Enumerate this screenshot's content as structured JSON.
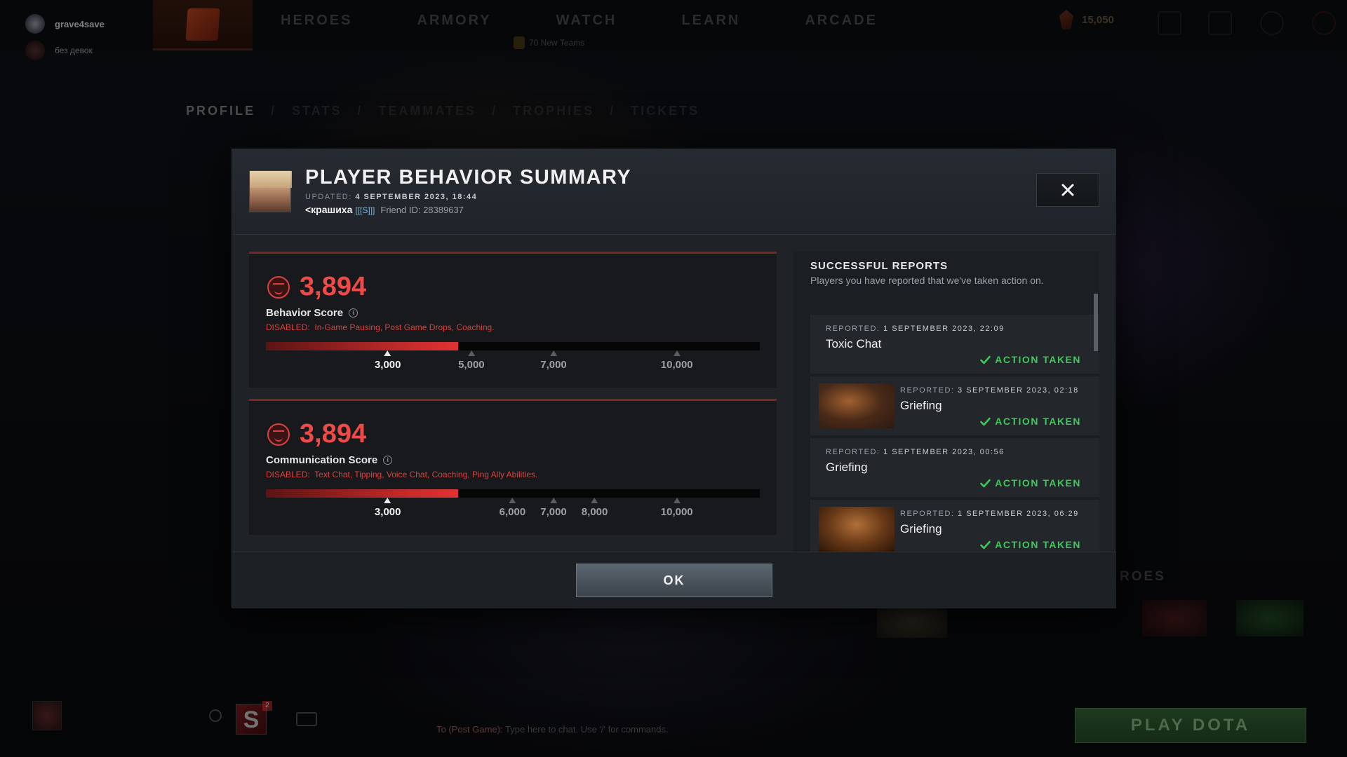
{
  "topbar": {
    "users": [
      {
        "name": "grave4save"
      },
      {
        "name": "без девок"
      }
    ],
    "nav": [
      "HEROES",
      "ARMORY",
      "WATCH",
      "LEARN",
      "ARCADE"
    ],
    "teams_notice": "70 New Teams",
    "shards": "15,050"
  },
  "profile_nav": [
    "PROFILE",
    "STATS",
    "TEAMMATES",
    "TROPHIES",
    "TICKETS"
  ],
  "modal": {
    "title": "PLAYER BEHAVIOR SUMMARY",
    "updated_label": "UPDATED:",
    "updated_value": "4 SEPTEMBER 2023, 18:44",
    "nickname": "<крашиха",
    "clan_tag": "[[[S]]]",
    "friend_id": "Friend ID: 28389637",
    "ok_label": "OK",
    "behavior": {
      "value": "3,894",
      "label": "Behavior Score",
      "disabled_prefix": "DISABLED:",
      "disabled_text": "In-Game Pausing, Post Game Drops, Coaching.",
      "fill_fraction": 0.3894,
      "ticks": [
        {
          "label": "3,000",
          "value": 3000,
          "current": true
        },
        {
          "label": "5,000",
          "value": 5000,
          "current": false
        },
        {
          "label": "7,000",
          "value": 7000,
          "current": false
        },
        {
          "label": "10,000",
          "value": 10000,
          "current": false
        }
      ]
    },
    "communication": {
      "value": "3,894",
      "label": "Communication Score",
      "disabled_prefix": "DISABLED:",
      "disabled_text": "Text Chat, Tipping, Voice Chat, Coaching, Ping Ally Abilities.",
      "fill_fraction": 0.3894,
      "ticks": [
        {
          "label": "3,000",
          "value": 3000,
          "current": true
        },
        {
          "label": "6,000",
          "value": 6000,
          "current": false
        },
        {
          "label": "7,000",
          "value": 7000,
          "current": false
        },
        {
          "label": "8,000",
          "value": 8000,
          "current": false
        },
        {
          "label": "10,000",
          "value": 10000,
          "current": false
        }
      ]
    },
    "reports": {
      "title": "SUCCESSFUL REPORTS",
      "subtitle": "Players you have reported that we've taken action on.",
      "items": [
        {
          "reported_label": "REPORTED:",
          "date": "1 SEPTEMBER 2023, 22:09",
          "type": "Toxic Chat",
          "status": "ACTION TAKEN",
          "has_thumb": false
        },
        {
          "reported_label": "REPORTED:",
          "date": "3 SEPTEMBER 2023, 02:18",
          "type": "Griefing",
          "status": "ACTION TAKEN",
          "has_thumb": true
        },
        {
          "reported_label": "REPORTED:",
          "date": "1 SEPTEMBER 2023, 00:56",
          "type": "Griefing",
          "status": "ACTION TAKEN",
          "has_thumb": false
        },
        {
          "reported_label": "REPORTED:",
          "date": "1 SEPTEMBER 2023, 06:29",
          "type": "Griefing",
          "status": "ACTION TAKEN",
          "has_thumb": true
        }
      ]
    }
  },
  "bottom": {
    "chat_target": "To (Post Game):",
    "chat_placeholder": "Type here to chat. Use '/' for commands.",
    "play_label": "PLAY DOTA",
    "heroes_label": "ROES",
    "notif_count": "2"
  },
  "colors": {
    "score_red": "#ef4a47",
    "action_green": "#3fc85a"
  }
}
